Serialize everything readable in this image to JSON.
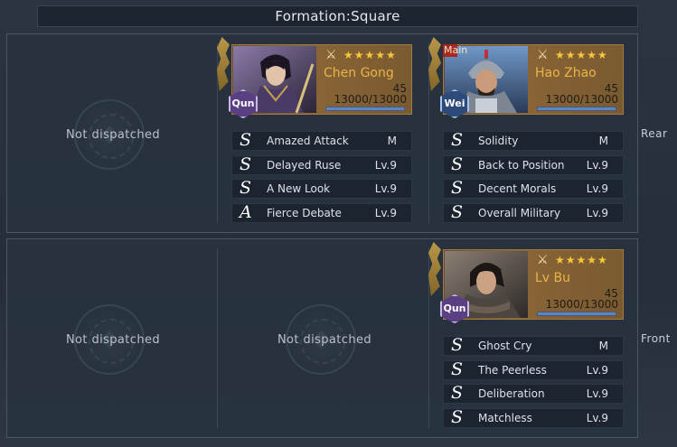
{
  "title": "Formation:Square",
  "rows": {
    "rear_label": "Rear",
    "front_label": "Front"
  },
  "empty_slot_text": "Not dispatched",
  "colors": {
    "name_gold": "#e8b44a",
    "star": "#f4c83a",
    "qun_faction": "#5b3f83",
    "wei_faction": "#2d4a7a"
  },
  "generals": {
    "chen_gong": {
      "name": "Chen Gong",
      "level": "45",
      "troops": "13000/13000",
      "troop_fraction": 1.0,
      "faction": "Qun",
      "stars": "★★★★★",
      "weapon_icon": "fan-weapon-icon",
      "skills": [
        {
          "grade": "S",
          "name": "Amazed Attack",
          "level": "M"
        },
        {
          "grade": "S",
          "name": "Delayed Ruse",
          "level": "Lv.9"
        },
        {
          "grade": "S",
          "name": "A New Look",
          "level": "Lv.9"
        },
        {
          "grade": "A",
          "name": "Fierce Debate",
          "level": "Lv.9"
        }
      ]
    },
    "hao_zhao": {
      "name": "Hao Zhao",
      "level": "45",
      "troops": "13000/13000",
      "troop_fraction": 1.0,
      "faction": "Wei",
      "main_tag": "Main",
      "stars": "★★★★★",
      "weapon_icon": "crossed-swords-icon",
      "skills": [
        {
          "grade": "S",
          "name": "Solidity",
          "level": "M"
        },
        {
          "grade": "S",
          "name": "Back to Position",
          "level": "Lv.9"
        },
        {
          "grade": "S",
          "name": "Decent Morals",
          "level": "Lv.9"
        },
        {
          "grade": "S",
          "name": "Overall Military",
          "level": "Lv.9"
        }
      ]
    },
    "lv_bu": {
      "name": "Lv Bu",
      "level": "45",
      "troops": "13000/13000",
      "troop_fraction": 1.0,
      "faction": "Qun",
      "stars": "★★★★★",
      "weapon_icon": "halberd-icon",
      "skills": [
        {
          "grade": "S",
          "name": "Ghost Cry",
          "level": "M"
        },
        {
          "grade": "S",
          "name": "The Peerless",
          "level": "Lv.9"
        },
        {
          "grade": "S",
          "name": "Deliberation",
          "level": "Lv.9"
        },
        {
          "grade": "S",
          "name": "Matchless",
          "level": "Lv.9"
        }
      ]
    }
  }
}
